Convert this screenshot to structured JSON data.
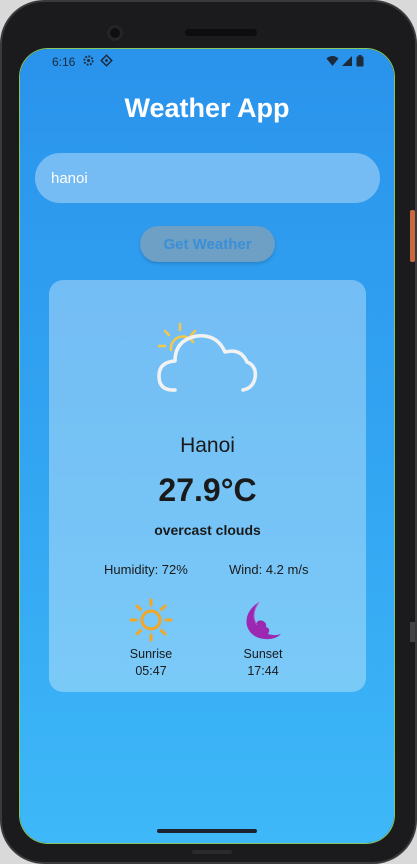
{
  "status_bar": {
    "time": "6:16"
  },
  "app": {
    "title": "Weather App"
  },
  "search": {
    "value": "hanoi",
    "placeholder": ""
  },
  "actions": {
    "get_weather_label": "Get Weather"
  },
  "weather": {
    "icon": "partly-cloudy-icon",
    "city": "Hanoi",
    "temperature": "27.9°C",
    "description": "overcast clouds",
    "humidity": "Humidity: 72%",
    "wind": "Wind: 4.2 m/s",
    "sunrise_label": "Sunrise",
    "sunrise_time": "05:47",
    "sunset_label": "Sunset",
    "sunset_time": "17:44"
  },
  "colors": {
    "background_top": "#2a93ec",
    "background_bottom": "#3eb8f8",
    "sun_icon": "#f5a623",
    "moon_icon": "#9c27b0",
    "button_text": "#3b8fd6"
  }
}
